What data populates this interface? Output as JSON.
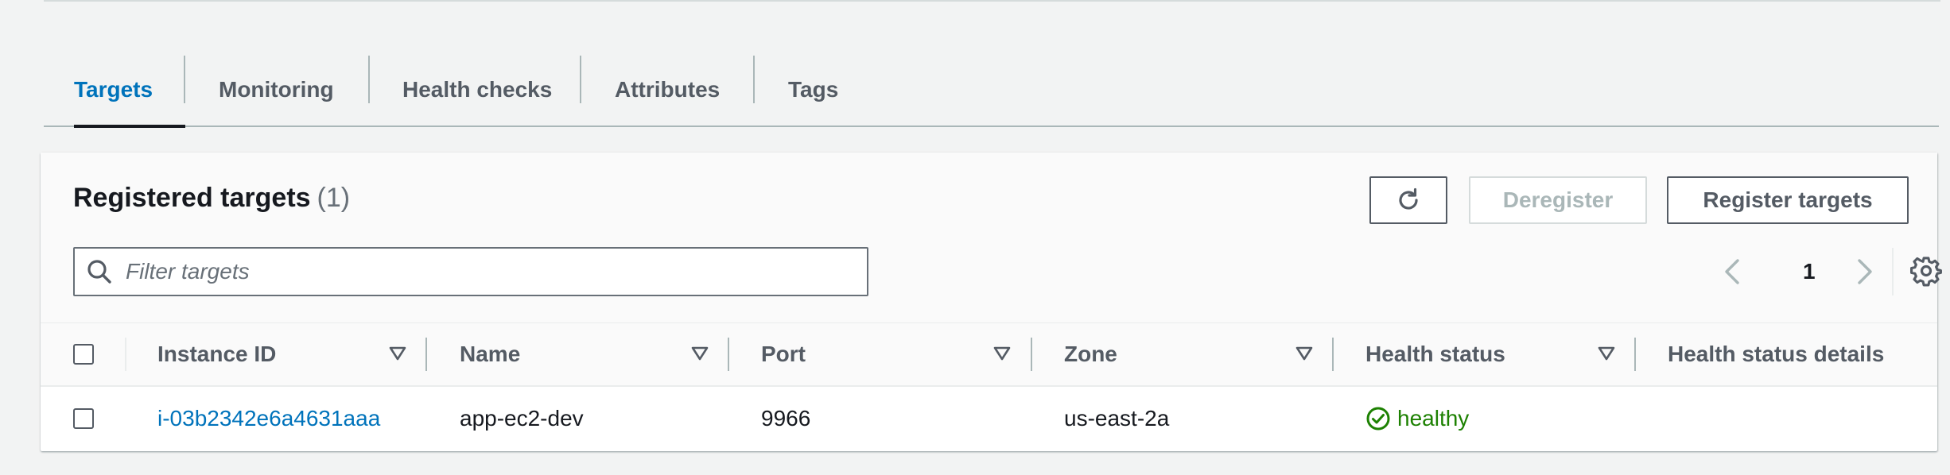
{
  "tabs": [
    {
      "label": "Targets",
      "active": true
    },
    {
      "label": "Monitoring",
      "active": false
    },
    {
      "label": "Health checks",
      "active": false
    },
    {
      "label": "Attributes",
      "active": false
    },
    {
      "label": "Tags",
      "active": false
    }
  ],
  "panel": {
    "title": "Registered targets",
    "count": "(1)",
    "buttons": {
      "refresh_icon": "refresh-icon",
      "deregister": "Deregister",
      "register": "Register targets"
    },
    "filter": {
      "placeholder": "Filter targets",
      "value": ""
    },
    "pagination": {
      "current_page": "1"
    }
  },
  "table": {
    "columns": [
      "Instance ID",
      "Name",
      "Port",
      "Zone",
      "Health status",
      "Health status details"
    ],
    "rows": [
      {
        "instance_id": "i-03b2342e6a4631aaa",
        "name": "app-ec2-dev",
        "port": "9966",
        "zone": "us-east-2a",
        "health_status": "healthy",
        "health_status_details": ""
      }
    ]
  },
  "colors": {
    "accent": "#0073bb",
    "healthy": "#1d8102",
    "border": "#545b64"
  }
}
